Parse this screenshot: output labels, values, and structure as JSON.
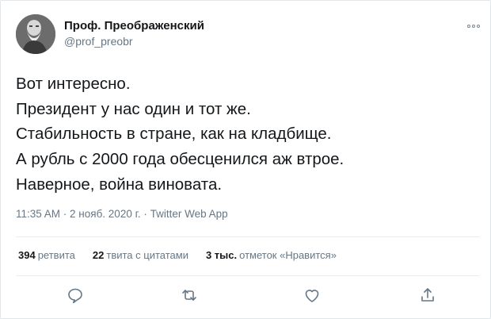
{
  "author": {
    "display_name": "Проф. Преображенский",
    "handle": "@prof_preobr"
  },
  "tweet": {
    "lines": [
      "Вот интересно.",
      "Президент у нас один и тот же.",
      "Стабильность в стране, как на кладбище.",
      "А рубль с 2000 года обесценился аж втрое.",
      "Наверное, война виновата."
    ],
    "meta": "11:35 AM · 2 нояб. 2020 г. · Twitter Web App"
  },
  "stats": {
    "retweets_count": "394",
    "retweets_label": "ретвита",
    "quotes_count": "22",
    "quotes_label": "твита с цитатами",
    "likes_count": "3 тыс.",
    "likes_label": "отметок «Нравится»"
  },
  "icons": {
    "more": "more-horizontal-icon",
    "reply": "reply-icon",
    "retweet": "retweet-icon",
    "like": "heart-icon",
    "share": "share-icon"
  },
  "colors": {
    "text": "#14171a",
    "secondary": "#657786",
    "divider": "#e6ecf0"
  }
}
